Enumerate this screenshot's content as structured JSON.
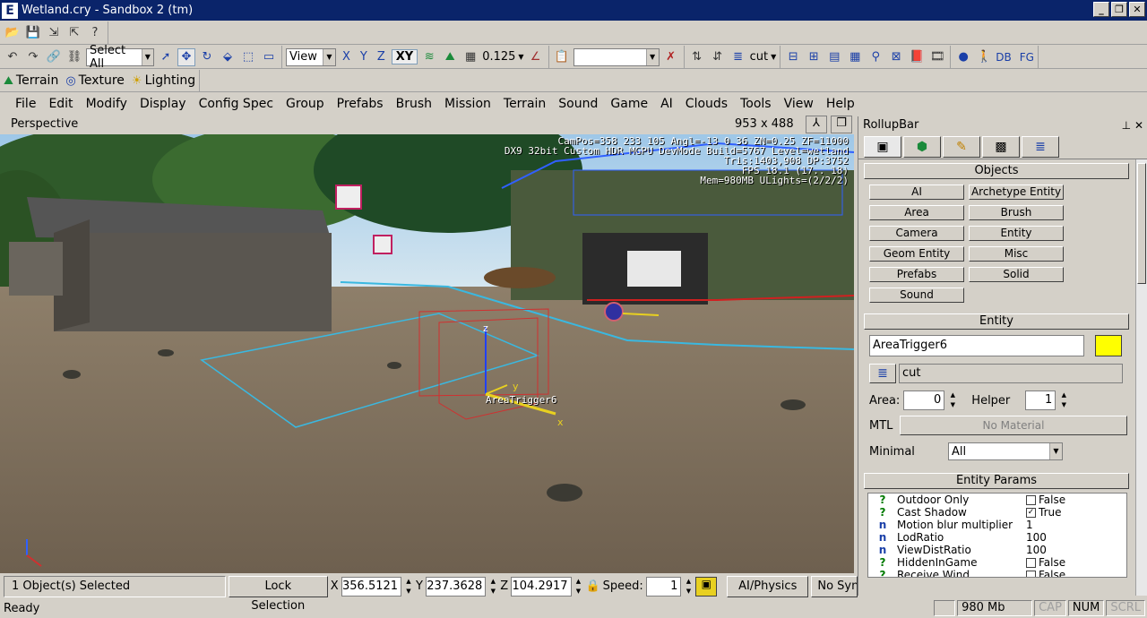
{
  "window": {
    "title": "Wetland.cry - Sandbox 2 (tm)",
    "app_icon": "E"
  },
  "toolbar1": {
    "icons": [
      "open-icon",
      "save-icon",
      "export-icon",
      "import-icon",
      "help-icon"
    ]
  },
  "toolbar2": {
    "select_all": "Select All",
    "coord_system": "View",
    "axis_x": "X",
    "axis_y": "Y",
    "axis_z": "Z",
    "axis_xy": "XY",
    "grid_size": "0.125",
    "layer": "cut",
    "db_label": "DB",
    "fg_label": "FG"
  },
  "toolbar3": {
    "terrain": "Terrain",
    "texture": "Texture",
    "lighting": "Lighting"
  },
  "menu": [
    "File",
    "Edit",
    "Modify",
    "Display",
    "Config Spec",
    "Group",
    "Prefabs",
    "Brush",
    "Mission",
    "Terrain",
    "Sound",
    "Game",
    "AI",
    "Clouds",
    "Tools",
    "View",
    "Help"
  ],
  "viewport": {
    "name": "Perspective",
    "size": "953 x 488",
    "hud": [
      "CamPos=358 233 105 Angl=-13  0  36 ZN=0.25 ZF=11000",
      "DX9 32bit Custom HDR MGPU DevMode Build=5767 Level=wetland",
      "Tris:1403,908  DP:3752",
      "FPS 18.1 (17.. 18)",
      "Mem=980MB ULights=(2/2/2)"
    ],
    "selected_label": "AreaTrigger6",
    "gizmo_x": "x",
    "gizmo_y": "y",
    "gizmo_z": "z"
  },
  "rollup": {
    "title": "RollupBar",
    "objects_header": "Objects",
    "objects": [
      "AI",
      "Archetype Entity",
      "Area",
      "Brush",
      "Camera",
      "Entity",
      "Geom Entity",
      "Misc",
      "Prefabs",
      "Solid",
      "Sound"
    ],
    "entity_header": "Entity",
    "entity_name": "AreaTrigger6",
    "entity_color": "#ffff00",
    "layer": "cut",
    "area_label": "Area:",
    "area_value": "0",
    "helper_label": "Helper",
    "helper_value": "1",
    "mtl_label": "MTL",
    "mtl_value": "No Material",
    "minimal_label": "Minimal",
    "minimal_value": "All",
    "params_header": "Entity Params",
    "params": [
      {
        "type": "?",
        "name": "Outdoor Only",
        "checkbox": true,
        "checked": false,
        "value": "False"
      },
      {
        "type": "?",
        "name": "Cast Shadow",
        "checkbox": true,
        "checked": true,
        "value": "True"
      },
      {
        "type": "n",
        "name": "Motion blur multiplier",
        "checkbox": false,
        "checked": false,
        "value": "1"
      },
      {
        "type": "n",
        "name": "LodRatio",
        "checkbox": false,
        "checked": false,
        "value": "100"
      },
      {
        "type": "n",
        "name": "ViewDistRatio",
        "checkbox": false,
        "checked": false,
        "value": "100"
      },
      {
        "type": "?",
        "name": "HiddenInGame",
        "checkbox": true,
        "checked": false,
        "value": "False"
      },
      {
        "type": "?",
        "name": "Receive Wind",
        "checkbox": true,
        "checked": false,
        "value": "False"
      }
    ]
  },
  "statusbar": {
    "selection": "1 Object(s) Selected",
    "lock": "Lock Selection",
    "x_label": "X",
    "x": "356.5121",
    "y_label": "Y",
    "y": "237.3628",
    "z_label": "Z",
    "z": "104.2917",
    "speed_label": "Speed:",
    "speed": "1",
    "ai_physics": "AI/Physics",
    "nosync": "No Sync",
    "ready": "Ready",
    "memory": "980 Mb",
    "cap": "CAP",
    "num": "NUM",
    "scrl": "SCRL"
  }
}
